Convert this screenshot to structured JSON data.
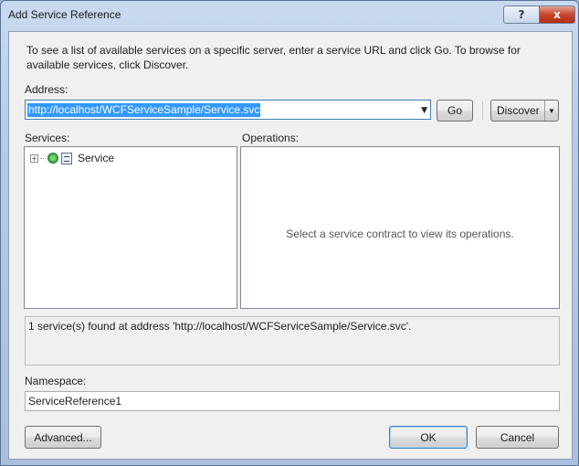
{
  "window": {
    "title": "Add Service Reference",
    "help_label": "?",
    "close_label": "x"
  },
  "intro_text": "To see a list of available services on a specific server, enter a service URL and click Go. To browse for available services, click Discover.",
  "address": {
    "label": "Address:",
    "value": "http://localhost/WCFServiceSample/Service.svc"
  },
  "buttons": {
    "go": "Go",
    "discover": "Discover",
    "advanced": "Advanced...",
    "ok": "OK",
    "cancel": "Cancel"
  },
  "services": {
    "label": "Services:",
    "items": [
      {
        "label": "Service",
        "expanded": false
      }
    ]
  },
  "operations": {
    "label": "Operations:",
    "placeholder": "Select a service contract to view its operations."
  },
  "status_text": "1 service(s) found at address 'http://localhost/WCFServiceSample/Service.svc'.",
  "namespace": {
    "label": "Namespace:",
    "value": "ServiceReference1"
  }
}
